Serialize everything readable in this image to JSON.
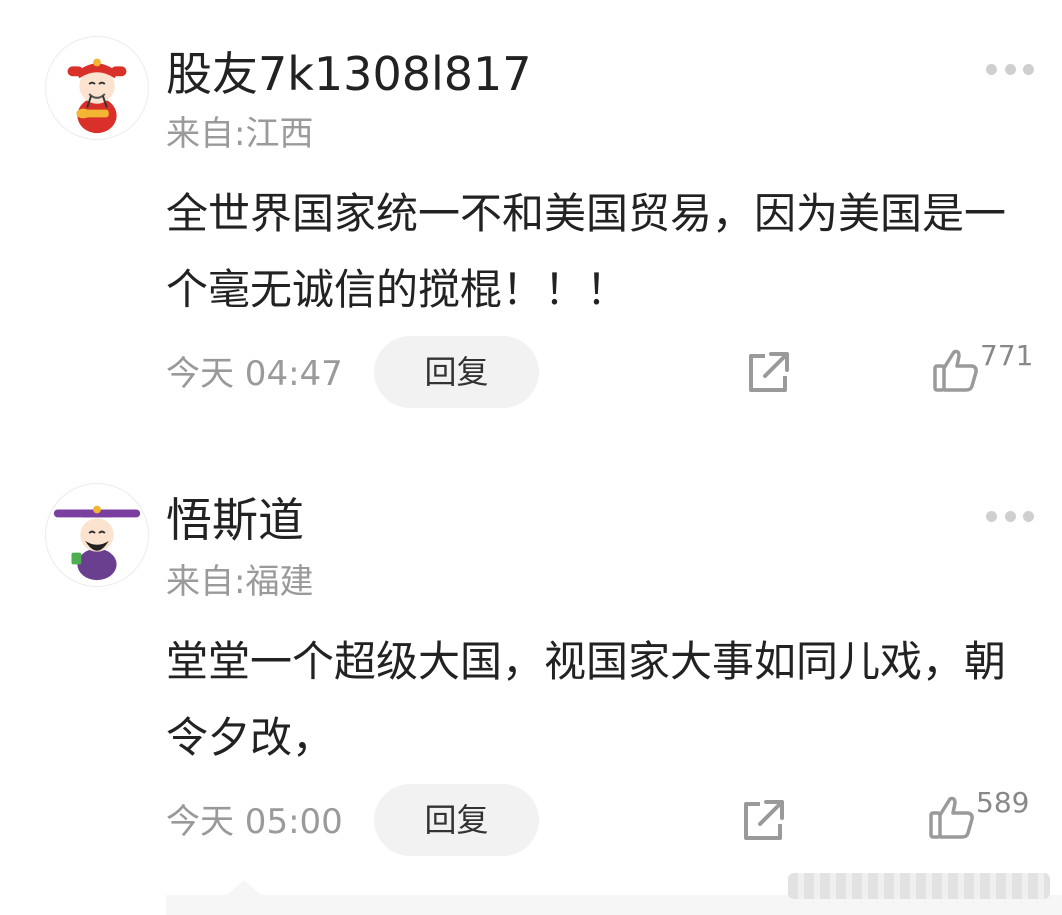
{
  "comments": [
    {
      "username": "股友7k1308l817",
      "location": "来自:江西",
      "text": "全世界国家统一不和美国贸易，因为美国是一个毫无诚信的搅棍！！！",
      "time": "今天 04:47",
      "reply_label": "回复",
      "likes": "771",
      "avatar_icon": "wealth-god-red-avatar-icon"
    },
    {
      "username": "悟斯道",
      "location": "来自:福建",
      "text": "堂堂一个超级大国，视国家大事如同儿戏，朝令夕改，",
      "time": "今天 05:00",
      "reply_label": "回复",
      "likes": "589",
      "avatar_icon": "wealth-god-purple-avatar-icon"
    }
  ],
  "colors": {
    "text": "#222222",
    "meta": "#9a9a9a",
    "reply_bg": "#f2f2f2",
    "icon": "#9a9a9a"
  }
}
